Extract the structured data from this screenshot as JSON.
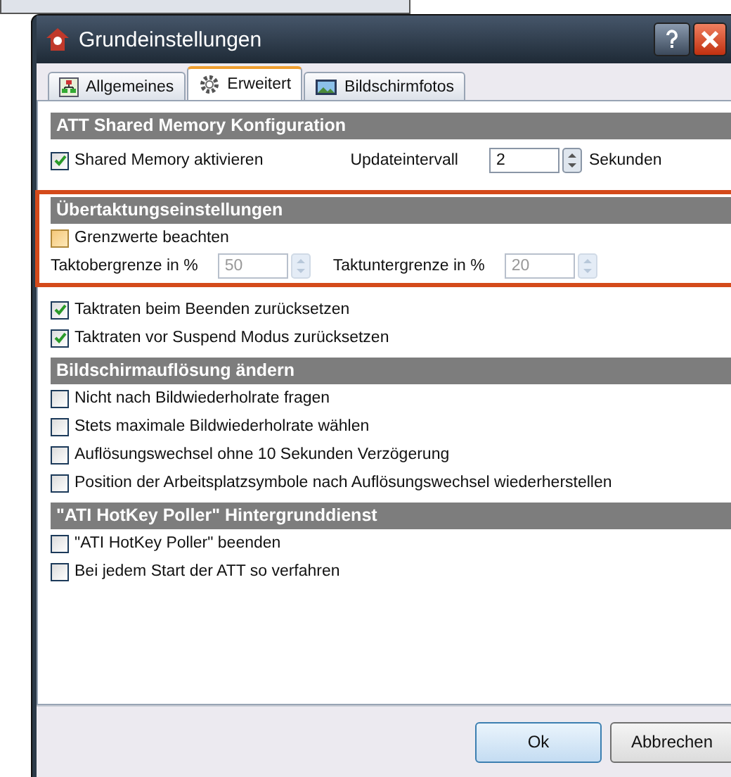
{
  "window": {
    "title": "Grundeinstellungen"
  },
  "tabs": [
    {
      "label": "Allgemeines",
      "selected": false,
      "kind": "chart"
    },
    {
      "label": "Erweitert",
      "selected": true,
      "kind": "gear"
    },
    {
      "label": "Bildschirmfotos",
      "selected": false,
      "kind": "picture"
    }
  ],
  "sections": [
    {
      "title": "ATT Shared Memory Konfiguration",
      "highlighted": false,
      "rows": [
        {
          "items": [
            {
              "kind": "checkbox",
              "label": "Shared Memory aktivieren",
              "checked": true
            },
            {
              "kind": "label",
              "text": "Updateintervall"
            },
            {
              "kind": "spin",
              "value": "2",
              "disabled": false
            },
            {
              "kind": "label",
              "text": "Sekunden"
            }
          ]
        }
      ]
    },
    {
      "title": "Übertaktungseinstellungen",
      "highlighted": true,
      "rows": [
        {
          "items": [
            {
              "kind": "checkbox",
              "label": "Grenzwerte beachten",
              "checked": false,
              "hovered": true
            }
          ]
        },
        {
          "items": [
            {
              "kind": "label",
              "text": "Taktobergrenze in %"
            },
            {
              "kind": "spin",
              "value": "50",
              "disabled": true
            },
            {
              "kind": "label",
              "text": "Taktuntergrenze in %"
            },
            {
              "kind": "spin",
              "value": "20",
              "disabled": true
            }
          ]
        }
      ]
    },
    {
      "highlighted": false,
      "rows": [
        {
          "items": [
            {
              "kind": "checkbox",
              "label": "Taktraten beim Beenden zurücksetzen",
              "checked": true
            }
          ]
        },
        {
          "items": [
            {
              "kind": "checkbox",
              "label": "Taktraten vor Suspend Modus zurücksetzen",
              "checked": true
            }
          ]
        }
      ]
    },
    {
      "title": "Bildschirmauflösung ändern",
      "highlighted": false,
      "rows": [
        {
          "items": [
            {
              "kind": "checkbox",
              "label": "Nicht nach Bildwiederholrate fragen",
              "checked": false
            }
          ]
        },
        {
          "items": [
            {
              "kind": "checkbox",
              "label": "Stets maximale Bildwiederholrate wählen",
              "checked": false
            }
          ]
        },
        {
          "items": [
            {
              "kind": "checkbox",
              "label": "Auflösungswechsel ohne 10 Sekunden Verzögerung",
              "checked": false
            }
          ]
        },
        {
          "items": [
            {
              "kind": "checkbox",
              "label": "Position der Arbeitsplatzsymbole nach Auflösungswechsel wiederherstellen",
              "checked": false
            }
          ]
        }
      ]
    },
    {
      "title": "\"ATI HotKey Poller\" Hintergrunddienst",
      "highlighted": false,
      "rows": [
        {
          "items": [
            {
              "kind": "checkbox",
              "label": "\"ATI HotKey Poller\" beenden",
              "checked": false
            }
          ]
        },
        {
          "items": [
            {
              "kind": "checkbox",
              "label": "Bei jedem Start der ATT so verfahren",
              "checked": false
            }
          ]
        }
      ]
    }
  ],
  "buttons": [
    {
      "label": "Ok",
      "default": true
    },
    {
      "label": "Abbrechen",
      "default": false
    }
  ]
}
